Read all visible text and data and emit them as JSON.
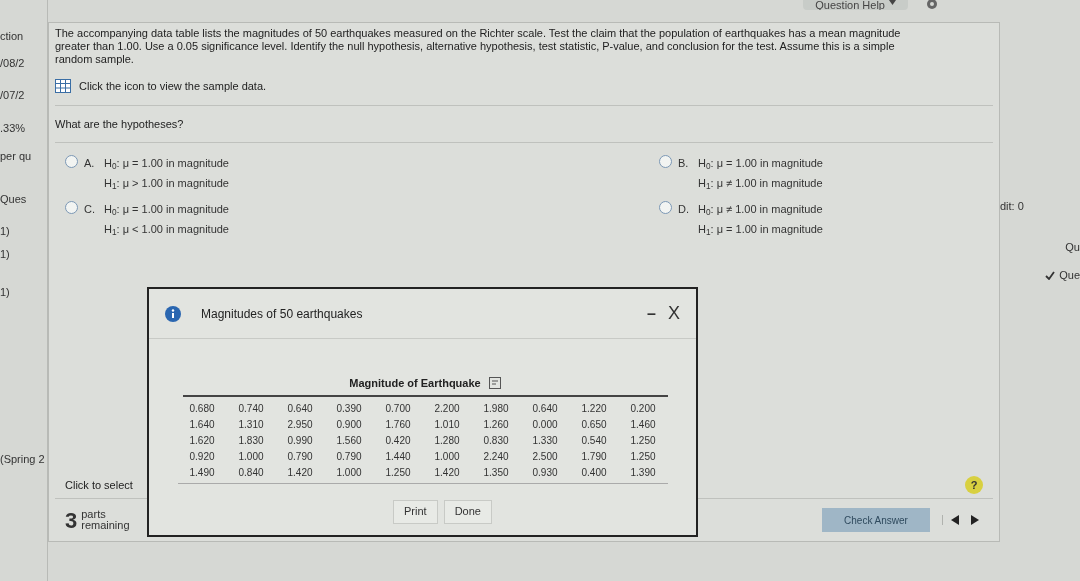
{
  "help_menu": {
    "label": "Question Help"
  },
  "left_strip": [
    "ction",
    "/08/2",
    "/07/2",
    ".33%",
    "per qu",
    "Ques",
    "1)",
    "1)",
    "1)",
    "(Spring 2"
  ],
  "right_strip": {
    "score": "dit: 0",
    "item_1": "Qu",
    "item_2": "Que"
  },
  "question": {
    "text": "The accompanying data table lists the magnitudes of 50 earthquakes measured on the Richter scale. Test the claim that the population of earthquakes has a mean magnitude greater than 1.00. Use a 0.05 significance level. Identify the null hypothesis, alternative hypothesis, test statistic, P-value, and conclusion for the test. Assume this is a simple random sample.",
    "data_link": "Click the icon to view the sample data.",
    "prompt": "What are the hypotheses?"
  },
  "options": [
    {
      "letter": "A.",
      "h0": "H$_{0}$: μ = 1.00 in magnitude",
      "h1": "H$_{1}$: μ > 1.00 in magnitude",
      "selected": false
    },
    {
      "letter": "B.",
      "h0": "H$_{0}$: μ = 1.00 in magnitude",
      "h1": "H$_{1}$: μ ≠ 1.00 in magnitude",
      "selected": false
    },
    {
      "letter": "C.",
      "h0": "H$_{0}$: μ = 1.00 in magnitude",
      "h1": "H$_{1}$: μ < 1.00 in magnitude",
      "selected": false
    },
    {
      "letter": "D.",
      "h0": "H$_{0}$: μ ≠ 1.00 in magnitude",
      "h1": "H$_{1}$: μ = 1.00 in magnitude",
      "selected": false
    }
  ],
  "footer": {
    "hint": "Click to select",
    "parts_count": "3",
    "parts_label": "parts",
    "remaining_label": "remaining",
    "check_button": "Check Answer",
    "check_disabled": true,
    "help": "?"
  },
  "dialog": {
    "title": "Magnitudes of 50 earthquakes",
    "minimize": "–",
    "close": "X",
    "table_title": "Magnitude of Earthquake",
    "rows": [
      [
        "0.680",
        "0.740",
        "0.640",
        "0.390",
        "0.700",
        "2.200",
        "1.980",
        "0.640",
        "1.220",
        "0.200"
      ],
      [
        "1.640",
        "1.310",
        "2.950",
        "0.900",
        "1.760",
        "1.010",
        "1.260",
        "0.000",
        "0.650",
        "1.460"
      ],
      [
        "1.620",
        "1.830",
        "0.990",
        "1.560",
        "0.420",
        "1.280",
        "0.830",
        "1.330",
        "0.540",
        "1.250"
      ],
      [
        "0.920",
        "1.000",
        "0.790",
        "0.790",
        "1.440",
        "1.000",
        "2.240",
        "2.500",
        "1.790",
        "1.250"
      ],
      [
        "1.490",
        "0.840",
        "1.420",
        "1.000",
        "1.250",
        "1.420",
        "1.350",
        "0.930",
        "0.400",
        "1.390"
      ]
    ],
    "buttons": [
      "Print",
      "Done"
    ]
  }
}
